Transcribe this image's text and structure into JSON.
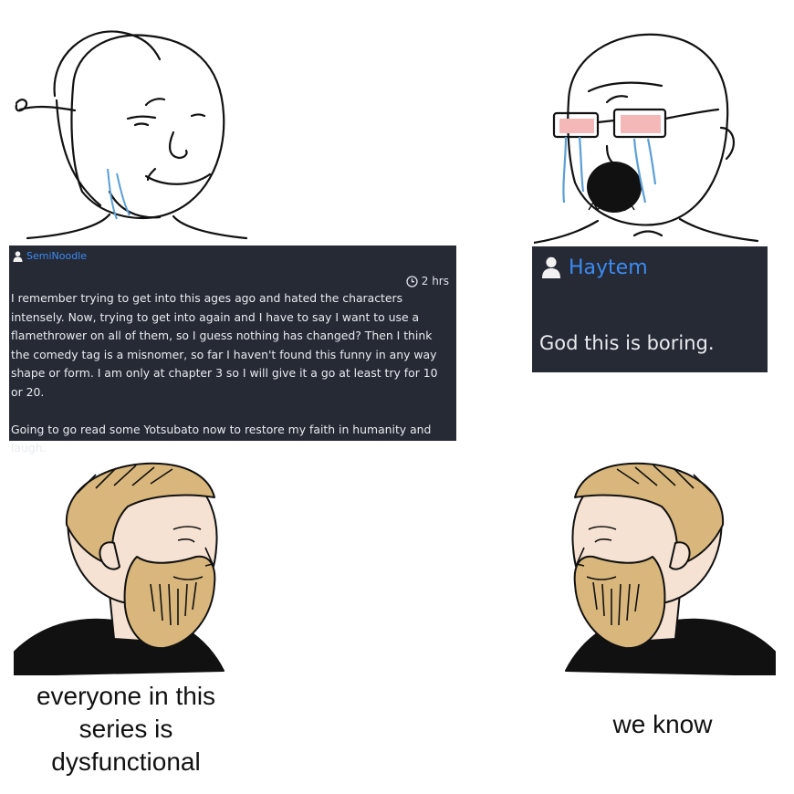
{
  "left_comment": {
    "username": "SemiNoodle",
    "time": "2 hrs",
    "paragraphs": [
      "I remember trying to get into this ages ago and hated the characters intensely. Now, trying to get into again and I have to say I want to use a flamethrower on all of them, so I guess nothing has changed? Then I think the comedy tag is a misnomer, so far I haven't found this funny in any way shape or form. I am only at chapter 3 so I will give it a go at least try for 10 or 20.",
      "Going to go read some Yotsubato now to restore my faith in humanity and laugh."
    ]
  },
  "right_comment": {
    "username": "Haytem",
    "text": "God this is boring."
  },
  "captions": {
    "left": "everyone in this series is dysfunctional",
    "right": "we know"
  },
  "colors": {
    "card_bg": "#262a35",
    "username": "#3b8bf2",
    "beard": "#d9b77c"
  },
  "icons": [
    "user-icon",
    "clock-icon"
  ]
}
